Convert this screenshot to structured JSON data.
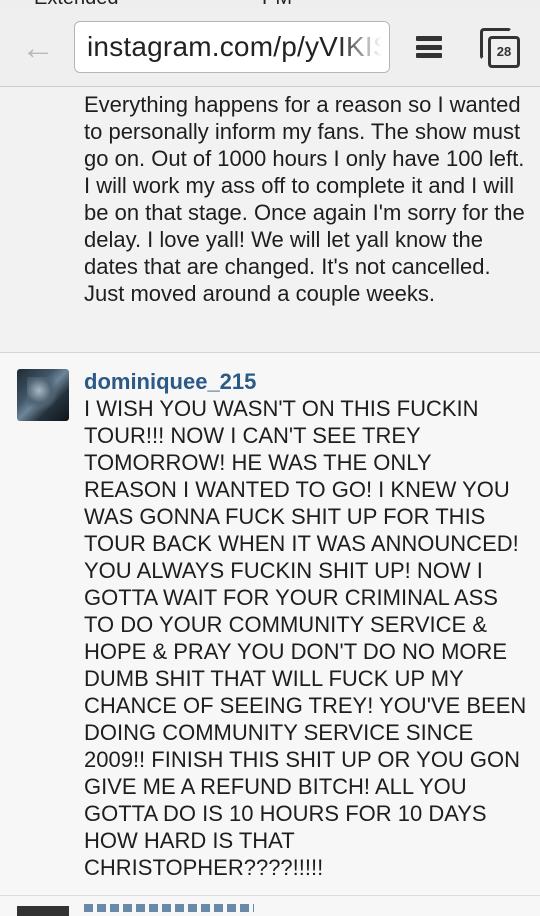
{
  "status_bar": {
    "carrier": "Extended",
    "time": "PM"
  },
  "browser": {
    "url": "instagram.com/p/yVIKIS",
    "tab_count": "28"
  },
  "caption": {
    "text": "Everything happens for a reason so I wanted to personally inform my fans. The show must go on. Out of 1000 hours I only have 100 left. I will work my ass off to complete it and I will be on that stage. Once again I'm sorry for the delay. I love yall! We will let yall know the dates that are changed. It's not cancelled. Just moved around a couple weeks."
  },
  "comment": {
    "username": "dominiquee_215",
    "text": "I WISH YOU WASN'T ON THIS FUCKIN TOUR!!! NOW I CAN'T SEE TREY TOMORROW! HE WAS THE ONLY REASON I WANTED TO GO! I KNEW YOU WAS GONNA FUCK SHIT UP FOR THIS TOUR BACK WHEN IT WAS ANNOUNCED! YOU ALWAYS FUCKIN SHIT UP! NOW I GOTTA WAIT FOR YOUR CRIMINAL ASS TO DO YOUR COMMUNITY SERVICE & HOPE & PRAY YOU DON'T DO NO MORE DUMB SHIT THAT WILL FUCK UP MY CHANCE OF SEEING TREY! YOU'VE BEEN DOING COMMUNITY SERVICE SINCE 2009!! FINISH THIS SHIT UP OR YOU GON GIVE ME A REFUND BITCH! ALL YOU GOTTA DO IS 10 HOURS FOR 10 DAYS HOW HARD IS THAT CHRISTOPHER????!!!!!"
  },
  "icons": {
    "back": "back-arrow-icon",
    "menu": "menu-icon",
    "tabs": "tabs-icon",
    "avatar": "user-avatar"
  },
  "colors": {
    "username": "#2a5a85",
    "text": "#1e1e1e",
    "toolbar": "#efefef"
  }
}
